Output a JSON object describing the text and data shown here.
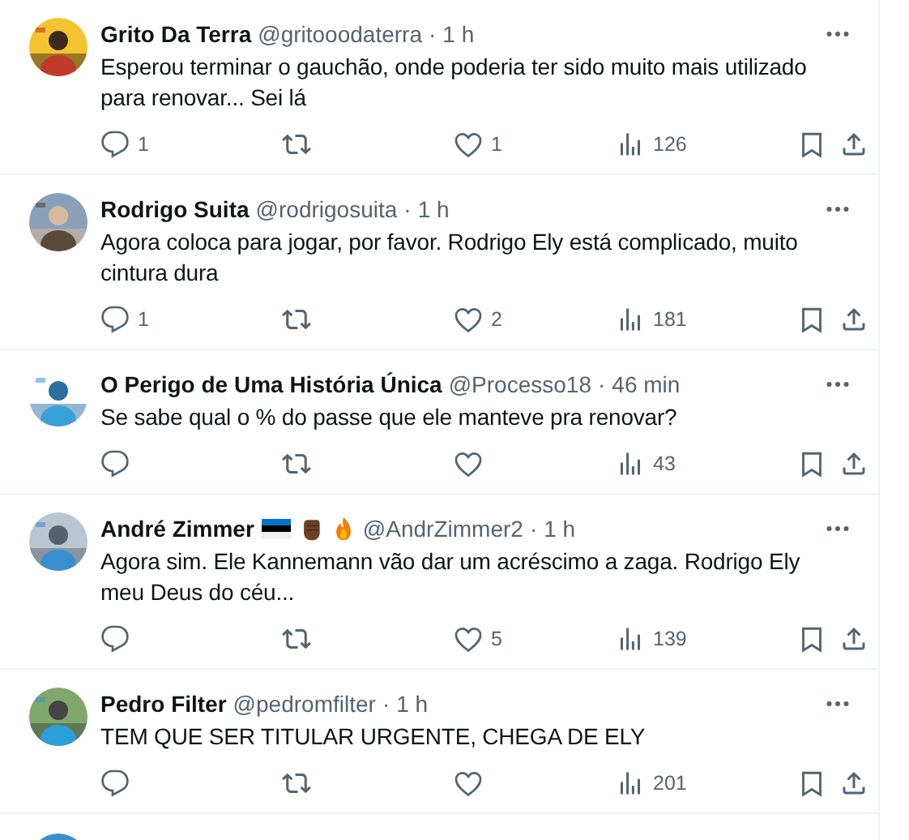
{
  "tweets": [
    {
      "name": "Grito Da Terra",
      "handle": "@gritooodaterra",
      "separator": "·",
      "time": "1 h",
      "text": "Esperou terminar o gauchão, onde poderia ter sido muito mais utilizado para renovar... Sei lá",
      "replies": "1",
      "likes": "1",
      "views": "126"
    },
    {
      "name": "Rodrigo Suita",
      "handle": "@rodrigosuita",
      "separator": "·",
      "time": "1 h",
      "text": "Agora coloca para jogar, por favor. Rodrigo Ely está complicado, muito cintura dura",
      "replies": "1",
      "likes": "2",
      "views": "181"
    },
    {
      "name": "O Perigo de Uma História Única",
      "handle": "@Processo18",
      "separator": "·",
      "time": "46 min",
      "text": "Se sabe qual o % do passe que ele manteve pra renovar?",
      "views": "43"
    },
    {
      "name": "André Zimmer",
      "handle": "@AndrZimmer2",
      "separator": "·",
      "time": "1 h",
      "text": "Agora sim. Ele Kannemann vão dar um acréscimo a zaga. Rodrigo Ely meu Deus do céu...",
      "likes": "5",
      "views": "139",
      "badges": [
        {
          "kind": "flag"
        },
        {
          "kind": "fist"
        },
        {
          "kind": "fire"
        }
      ]
    },
    {
      "name": "Pedro Filter",
      "handle": "@pedromfilter",
      "separator": "·",
      "time": "1 h",
      "text": "TEM QUE SER TITULAR URGENTE, CHEGA DE ELY",
      "views": "201"
    }
  ]
}
